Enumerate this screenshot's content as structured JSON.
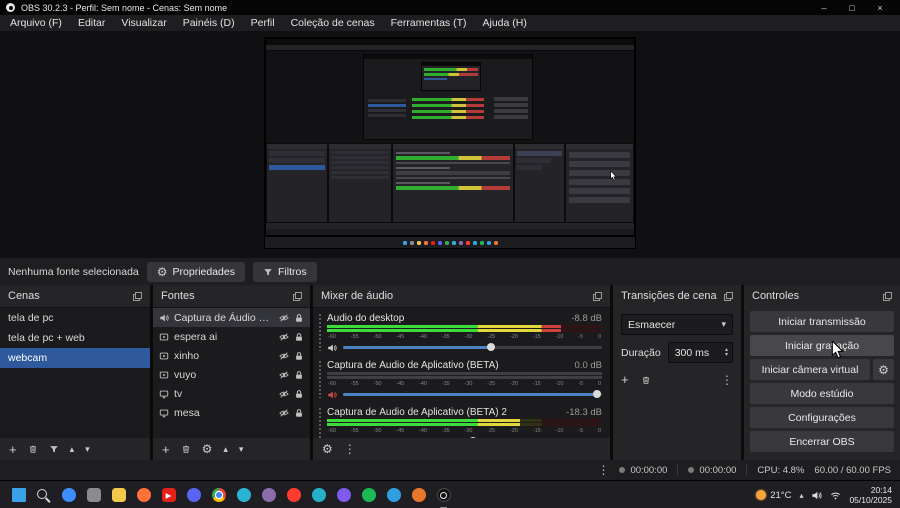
{
  "window": {
    "title": "OBS 30.2.3 - Perfil: Sem nome - Cenas: Sem nome"
  },
  "icons": {
    "minimize": "–",
    "maximize": "□",
    "close": "×",
    "chevron_down": "▾",
    "chevron_up": "▴",
    "plus": "+",
    "kebab": "⋮",
    "gear": "⚙"
  },
  "menubar": {
    "items": [
      "Arquivo (F)",
      "Editar",
      "Visualizar",
      "Painéis (D)",
      "Perfil",
      "Coleção de cenas",
      "Ferramentas (T)",
      "Ajuda (H)"
    ]
  },
  "toolbar": {
    "status": "Nenhuma fonte selecionada",
    "properties": "Propriedades",
    "filters": "Filtros"
  },
  "scenes": {
    "title": "Cenas",
    "items": [
      {
        "label": "tela de pc",
        "selected": false
      },
      {
        "label": "tela de pc + web",
        "selected": false
      },
      {
        "label": "webcam",
        "selected": true
      }
    ]
  },
  "sources": {
    "title": "Fontes",
    "items": [
      {
        "label": "Captura de Áudio de A",
        "icon": "speaker",
        "selected": true
      },
      {
        "label": "espera ai",
        "icon": "media",
        "selected": false
      },
      {
        "label": "xinho",
        "icon": "media",
        "selected": false
      },
      {
        "label": "vuyo",
        "icon": "media",
        "selected": false
      },
      {
        "label": "tv",
        "icon": "display",
        "selected": false
      },
      {
        "label": "mesa",
        "icon": "display",
        "selected": false
      }
    ]
  },
  "mixer": {
    "title": "Mixer de áudio",
    "scale": [
      "-60",
      "-55",
      "-50",
      "-45",
      "-40",
      "-35",
      "-30",
      "-25",
      "-20",
      "-15",
      "-10",
      "-5",
      "0"
    ],
    "channels": [
      {
        "name": "Áudio do desktop",
        "db": "-8.8 dB",
        "level": 85,
        "slider": 57,
        "muted": false
      },
      {
        "name": "Captura de Áudio de Aplicativo (BETA)",
        "db": "0.0 dB",
        "level": 0,
        "slider": 98,
        "muted": true
      },
      {
        "name": "Captura de Áudio de Aplicativo (BETA) 2",
        "db": "-18.3 dB",
        "level": 70,
        "slider": 50,
        "muted": false
      }
    ]
  },
  "transitions": {
    "title": "Transições de cena",
    "selected": "Esmaecer",
    "duration_label": "Duração",
    "duration_value": "300 ms"
  },
  "controls": {
    "title": "Controles",
    "buttons": [
      {
        "label": "Iniciar transmissão"
      },
      {
        "label": "Iniciar gravação"
      },
      {
        "label": "Iniciar câmera virtual"
      },
      {
        "label": "Modo estúdio"
      },
      {
        "label": "Configurações"
      },
      {
        "label": "Encerrar OBS"
      }
    ]
  },
  "statusbar": {
    "rec_time": "00:00:00",
    "stream_time": "00:00:00",
    "cpu": "CPU: 4.8%",
    "fps": "60.00 / 60.00 FPS"
  },
  "taskbar": {
    "temperature": "21°C",
    "time": "20:14",
    "date": "05/10/2025",
    "icons": [
      {
        "name": "start",
        "shape": "win",
        "color": "#3aa0e8"
      },
      {
        "name": "search",
        "shape": "search",
        "color": "#cfcfcf"
      },
      {
        "name": "copilot",
        "shape": "circle",
        "color": "#3f8cff"
      },
      {
        "name": "task-view",
        "shape": "square",
        "color": "#8a8a8f"
      },
      {
        "name": "file-explorer",
        "shape": "square",
        "color": "#f3c84b"
      },
      {
        "name": "firefox",
        "shape": "circle",
        "color": "#ff7139"
      },
      {
        "name": "youtube",
        "shape": "square",
        "color": "#e62117",
        "glyph": "▶"
      },
      {
        "name": "discord",
        "shape": "circle",
        "color": "#5865f2"
      },
      {
        "name": "chrome",
        "shape": "chrome",
        "color": "#4285f4"
      },
      {
        "name": "edge",
        "shape": "circle",
        "color": "#2bb3d6"
      },
      {
        "name": "gimp",
        "shape": "circle",
        "color": "#8d6cab"
      },
      {
        "name": "opera",
        "shape": "circle",
        "color": "#ff3b30"
      },
      {
        "name": "creative-cloud",
        "shape": "circle",
        "color": "#24b0c9"
      },
      {
        "name": "viber",
        "shape": "circle",
        "color": "#7f5af0"
      },
      {
        "name": "spotify",
        "shape": "circle",
        "color": "#1db954"
      },
      {
        "name": "telegram",
        "shape": "circle",
        "color": "#2f9fe0"
      },
      {
        "name": "paint",
        "shape": "circle",
        "color": "#e8762c"
      },
      {
        "name": "obs",
        "shape": "obs",
        "color": "#141414",
        "active": true
      }
    ]
  },
  "colors": {
    "accent_blue": "#2e5a9d",
    "meter_green": "#3ddc3d",
    "meter_yellow": "#e0d83c",
    "meter_red": "#cf4040",
    "panel": "#252528",
    "panel_dark": "#1b1b1d"
  }
}
